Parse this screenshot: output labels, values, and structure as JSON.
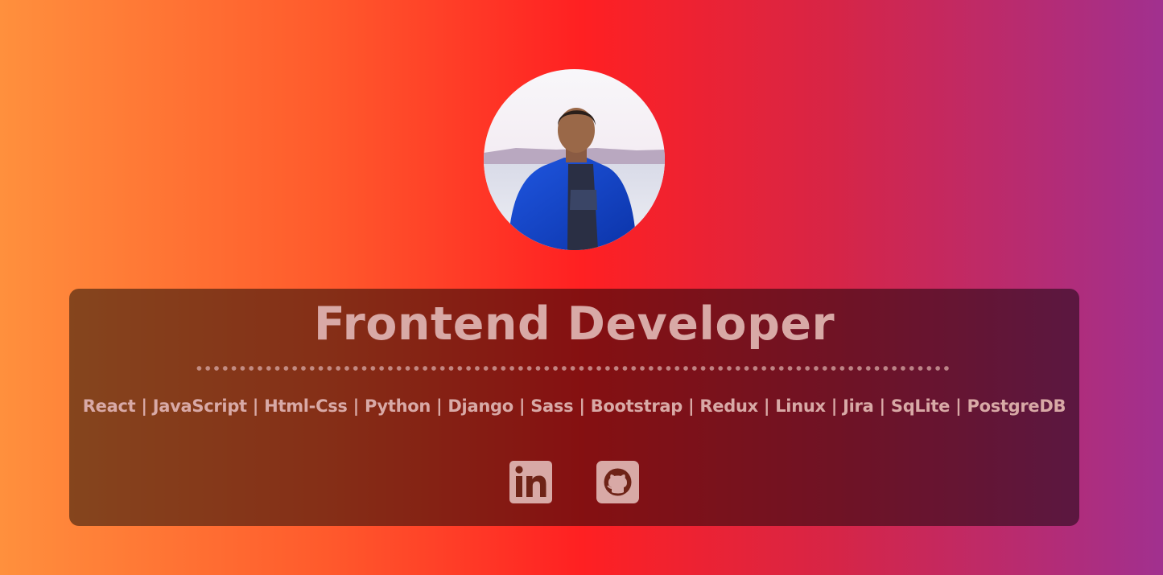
{
  "profile": {
    "avatar_icon": "profile-photo"
  },
  "card": {
    "title": "Frontend Developer",
    "skills": "React | JavaScript | Html-Css | Python | Django | Sass | Bootstrap | Redux | Linux | Jira | SqLite | PostgreDB"
  },
  "socials": [
    {
      "icon": "linkedin-icon"
    },
    {
      "icon": "github-icon"
    }
  ],
  "colors": {
    "gradient": [
      "#ff903d",
      "#ff2022",
      "#a1308f"
    ],
    "text": "#d8a9a6"
  }
}
